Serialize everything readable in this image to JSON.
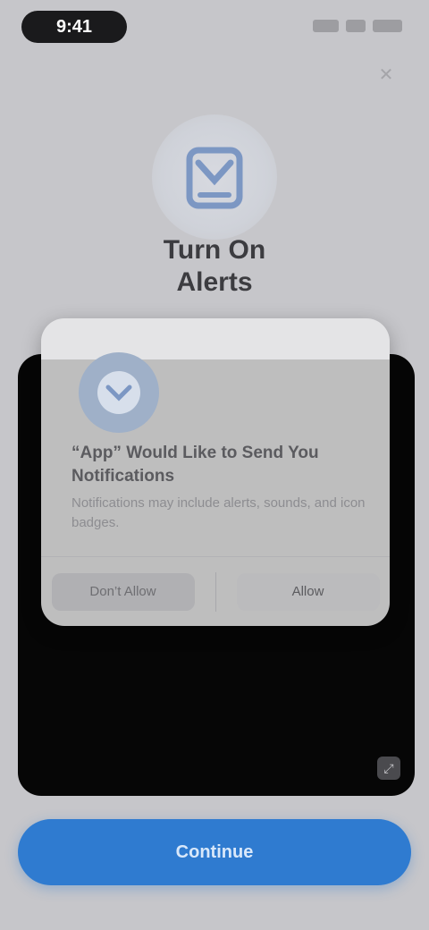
{
  "status_bar": {
    "time": "9:41"
  },
  "header": {
    "close_icon": "close-icon",
    "close_label": "✕"
  },
  "hero": {
    "icon": "shield-icon",
    "title_line1": "Turn On",
    "title_line2": "Alerts"
  },
  "alert": {
    "icon": "app-icon",
    "title": "“App” Would Like to Send You Notifications",
    "body": "Notifications may include alerts, sounds, and icon badges.",
    "dont_allow_label": "Don’t Allow",
    "allow_label": "Allow"
  },
  "phone": {
    "corner_icon": "expand-icon",
    "corner_glyph": "⤢"
  },
  "cta": {
    "label": "Continue"
  },
  "colors": {
    "background": "#c6c6ca",
    "accent": "#2f7bd0",
    "phone_frame": "#060606",
    "alert_card": "#bebebe"
  }
}
